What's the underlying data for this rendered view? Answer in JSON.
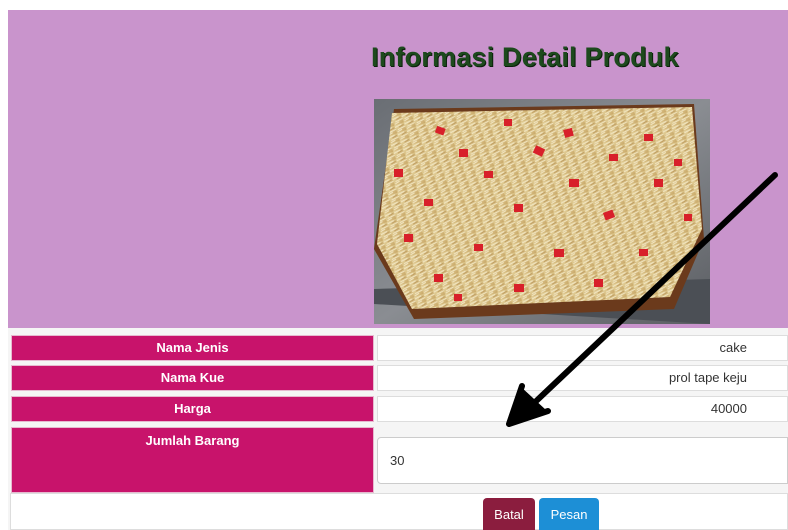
{
  "page": {
    "title": "Informasi Detail Produk"
  },
  "product": {
    "image_alt": "prol tape keju"
  },
  "details": {
    "rows": [
      {
        "label": "Nama Jenis",
        "value": "cake"
      },
      {
        "label": "Nama Kue",
        "value": "prol tape keju"
      },
      {
        "label": "Harga",
        "value": "40000"
      }
    ],
    "quantity": {
      "label": "Jumlah Barang",
      "value": "30"
    }
  },
  "actions": {
    "cancel_label": "Batal",
    "order_label": "Pesan"
  },
  "colors": {
    "panel_bg": "#c994cc",
    "label_bg": "#c8136b",
    "cancel_btn": "#8b1d3e",
    "order_btn": "#1d8fd6",
    "title": "#1d4a1d"
  },
  "icons": {
    "annotation": "arrow-icon"
  }
}
